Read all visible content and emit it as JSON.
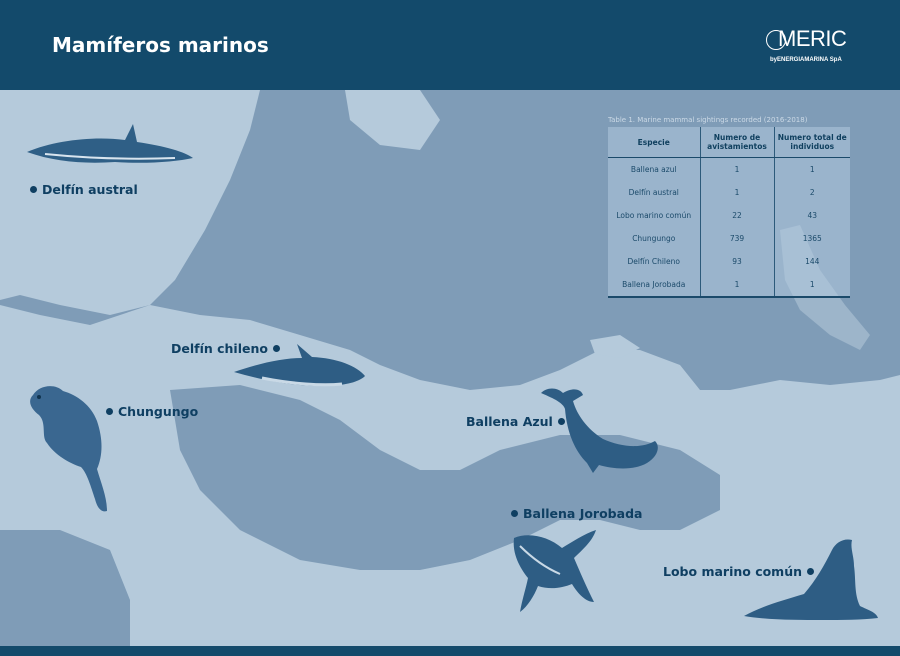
{
  "header": {
    "title": "Mamíferos marinos"
  },
  "logo": {
    "name": "MERIC",
    "tagline": "byENERGIAMARINA SpA"
  },
  "colors": {
    "header": "#134a6b",
    "sea": "#7f9cb7",
    "land": "#b5cadb",
    "marker": "#0f3f62"
  },
  "species_labels": {
    "delfin_austral": "Delfín austral",
    "delfin_chileno": "Delfín chileno",
    "chungungo": "Chungungo",
    "ballena_azul": "Ballena Azul",
    "ballena_jorobada": "Ballena Jorobada",
    "lobo_marino": "Lobo marino común"
  },
  "table": {
    "caption": "Table 1. Marine mammal sightings recorded (2016-2018)",
    "headers": [
      "Especie",
      "Numero de avistamientos",
      "Numero total de individuos"
    ],
    "rows": [
      [
        "Ballena azul",
        "1",
        "1"
      ],
      [
        "Delfín austral",
        "1",
        "2"
      ],
      [
        "Lobo marino común",
        "22",
        "43"
      ],
      [
        "Chungungo",
        "739",
        "1365"
      ],
      [
        "Delfín Chileno",
        "93",
        "144"
      ],
      [
        "Ballena Jorobada",
        "1",
        "1"
      ]
    ]
  }
}
